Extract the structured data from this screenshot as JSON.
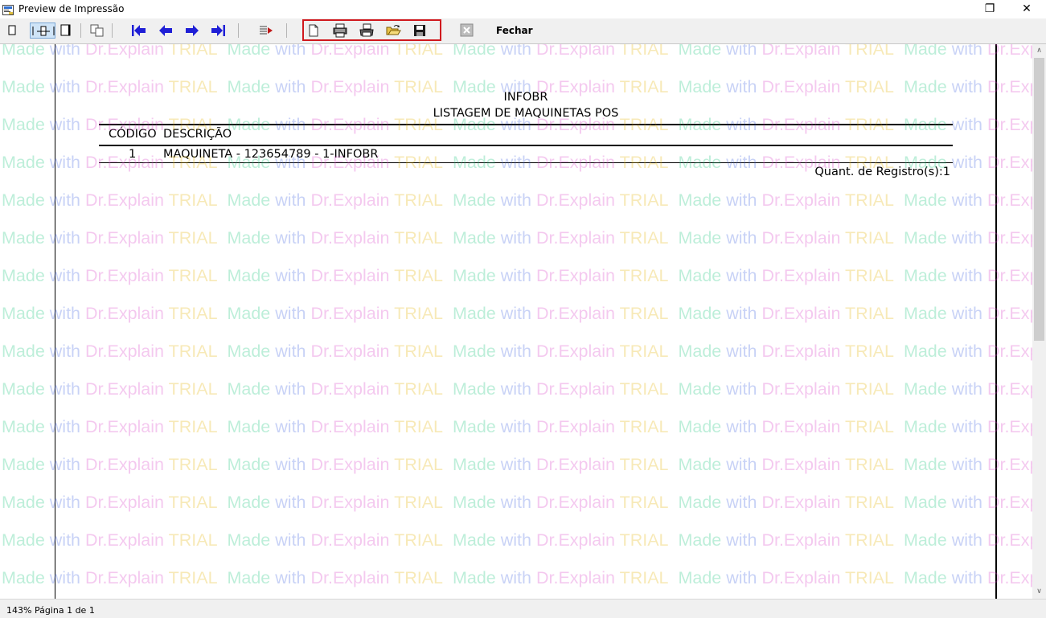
{
  "window": {
    "title": "Preview de Impressão",
    "restore_glyph": "❐",
    "close_glyph": "✕"
  },
  "toolbar": {
    "buttons": [
      {
        "name": "single-page-view",
        "icon": "page-icon"
      },
      {
        "name": "page-width-view",
        "icon": "page-width-icon",
        "pressed": true
      },
      {
        "name": "full-page-view",
        "icon": "full-page-icon"
      },
      {
        "name": "multi-page-view",
        "icon": "multi-page-icon"
      },
      {
        "name": "first-page",
        "icon": "arrow-first-icon"
      },
      {
        "name": "previous-page",
        "icon": "arrow-left-icon"
      },
      {
        "name": "next-page",
        "icon": "arrow-right-icon"
      },
      {
        "name": "last-page",
        "icon": "arrow-last-icon"
      },
      {
        "name": "go-to-page",
        "icon": "goto-page-icon"
      },
      {
        "name": "page-setup",
        "icon": "page-setup-icon"
      },
      {
        "name": "printer-setup",
        "icon": "printer-setup-icon"
      },
      {
        "name": "print",
        "icon": "print-icon"
      },
      {
        "name": "open-report",
        "icon": "open-folder-icon"
      },
      {
        "name": "save-report",
        "icon": "save-disk-icon"
      },
      {
        "name": "close-preview",
        "icon": "close-x-icon"
      }
    ],
    "close_label": "Fechar",
    "accent_highlight": "#d0191e",
    "nav_arrow_color": "#1f1fd6"
  },
  "watermark": {
    "word1": "Made",
    "word2": "with",
    "word3": "Dr.Explain",
    "word4": "TRIAL",
    "colors": [
      "#16c67a",
      "#3c5fe0",
      "#d940c9",
      "#e6b400"
    ]
  },
  "report": {
    "company": "INFOBR",
    "title": "LISTAGEM DE MAQUINETAS POS",
    "columns": [
      "CÓDIGO",
      "DESCRIÇÃO"
    ],
    "rows": [
      {
        "codigo": "1",
        "descricao": "MAQUINETA - 123654789 - 1-INFOBR"
      }
    ],
    "record_count": "Quant. de Registro(s):1"
  },
  "status": {
    "text": "143%  Página 1 de 1"
  },
  "scrollbar": {
    "up_glyph": "∧",
    "down_glyph": "∨"
  }
}
